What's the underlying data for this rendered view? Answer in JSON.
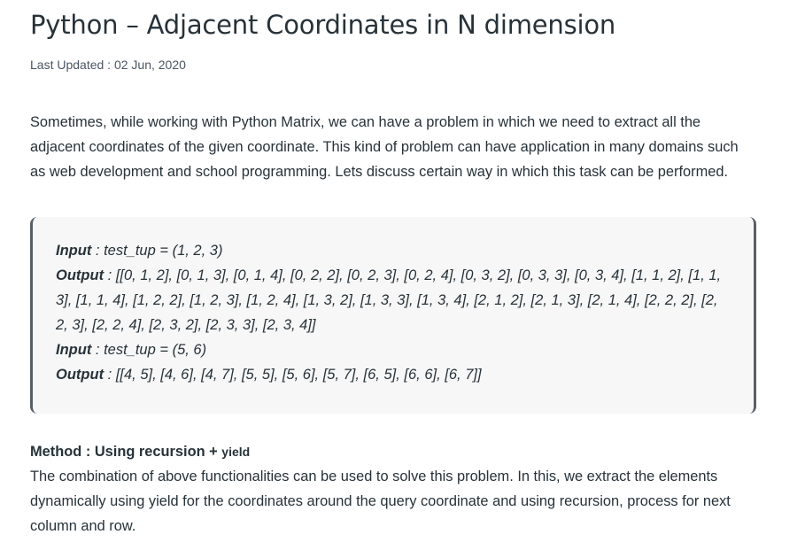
{
  "article": {
    "title": "Python – Adjacent Coordinates in N dimension",
    "last_updated": "Last Updated : 02 Jun, 2020",
    "intro": "Sometimes, while working with Python Matrix, we can have a problem in which we need to extract all the adjacent coordinates of the given coordinate. This kind of problem can have application in many domains such as web development and school programming. Lets discuss certain way in which this task can be performed."
  },
  "example": {
    "input_label": "Input",
    "output_label": "Output",
    "input1": " : test_tup = (1, 2, 3)",
    "output1": " : [[0, 1, 2], [0, 1, 3], [0, 1, 4], [0, 2, 2], [0, 2, 3], [0, 2, 4], [0, 3, 2], [0, 3, 3], [0, 3, 4], [1, 1, 2], [1, 1, 3], [1, 1, 4], [1, 2, 2], [1, 2, 3], [1, 2, 4], [1, 3, 2], [1, 3, 3], [1, 3, 4], [2, 1, 2], [2, 1, 3], [2, 1, 4], [2, 2, 2], [2, 2, 3], [2, 2, 4], [2, 3, 2], [2, 3, 3], [2, 3, 4]]",
    "input2": " : test_tup = (5, 6)",
    "output2": " : [[4, 5], [4, 6], [4, 7], [5, 5], [5, 6], [5, 7], [6, 5], [6, 6], [6, 7]]"
  },
  "method": {
    "heading": "Method : Using recursion + ",
    "heading_code": "yield",
    "text": "The combination of above functionalities can be used to solve this problem. In this, we extract the elements dynamically using yield for the coordinates around the query coordinate and using recursion, process for next column and row."
  }
}
